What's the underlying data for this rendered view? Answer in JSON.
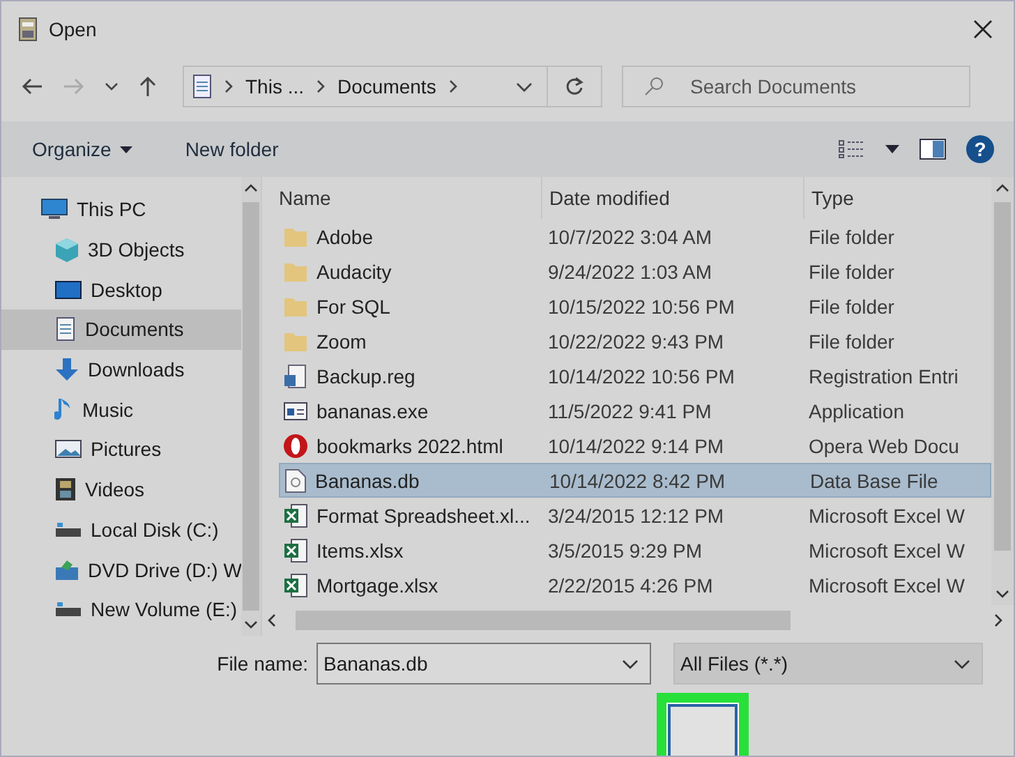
{
  "window": {
    "title": "Open"
  },
  "address": {
    "segments": [
      "This ...",
      "Documents"
    ],
    "search_placeholder": "Search Documents"
  },
  "toolbar": {
    "organize": "Organize",
    "new_folder": "New folder",
    "help": "?"
  },
  "sidebar": {
    "items": [
      {
        "label": "This PC",
        "kind": "pc",
        "selected": false,
        "children": [
          {
            "label": "3D Objects",
            "kind": "cube",
            "selected": false
          },
          {
            "label": "Desktop",
            "kind": "desktop",
            "selected": false
          },
          {
            "label": "Documents",
            "kind": "doc",
            "selected": true
          },
          {
            "label": "Downloads",
            "kind": "download",
            "selected": false
          },
          {
            "label": "Music",
            "kind": "music",
            "selected": false
          },
          {
            "label": "Pictures",
            "kind": "pictures",
            "selected": false
          },
          {
            "label": "Videos",
            "kind": "videos",
            "selected": false
          },
          {
            "label": "Local Disk (C:)",
            "kind": "disk",
            "selected": false
          },
          {
            "label": "DVD Drive (D:) W",
            "kind": "dvd",
            "selected": false
          },
          {
            "label": "New Volume (E:)",
            "kind": "disk",
            "selected": false
          }
        ]
      }
    ]
  },
  "table": {
    "columns": [
      "Name",
      "Date modified",
      "Type"
    ],
    "rows": [
      {
        "name": "Adobe",
        "date": "10/7/2022 3:04 AM",
        "type": "File folder",
        "kind": "folder",
        "selected": false
      },
      {
        "name": "Audacity",
        "date": "9/24/2022 1:03 AM",
        "type": "File folder",
        "kind": "folder",
        "selected": false
      },
      {
        "name": "For SQL",
        "date": "10/15/2022 10:56 PM",
        "type": "File folder",
        "kind": "folder",
        "selected": false
      },
      {
        "name": "Zoom",
        "date": "10/22/2022 9:43 PM",
        "type": "File folder",
        "kind": "folder",
        "selected": false
      },
      {
        "name": "Backup.reg",
        "date": "10/14/2022 10:56 PM",
        "type": "Registration Entri",
        "kind": "reg",
        "selected": false
      },
      {
        "name": "bananas.exe",
        "date": "11/5/2022 9:41 PM",
        "type": "Application",
        "kind": "exe",
        "selected": false
      },
      {
        "name": "bookmarks 2022.html",
        "date": "10/14/2022 9:14 PM",
        "type": "Opera Web Docu",
        "kind": "opera",
        "selected": false
      },
      {
        "name": "Bananas.db",
        "date": "10/14/2022 8:42 PM",
        "type": "Data Base File",
        "kind": "db",
        "selected": true
      },
      {
        "name": "Format Spreadsheet.xl...",
        "date": "3/24/2015 12:12 PM",
        "type": "Microsoft Excel W",
        "kind": "excel",
        "selected": false
      },
      {
        "name": "Items.xlsx",
        "date": "3/5/2015 9:29 PM",
        "type": "Microsoft Excel W",
        "kind": "excel",
        "selected": false
      },
      {
        "name": "Mortgage.xlsx",
        "date": "2/22/2015 4:26 PM",
        "type": "Microsoft Excel W",
        "kind": "excel",
        "selected": false
      }
    ]
  },
  "footer": {
    "file_name_label": "File name:",
    "file_name_value": "Bananas.db",
    "filter": "All Files (*.*)"
  }
}
